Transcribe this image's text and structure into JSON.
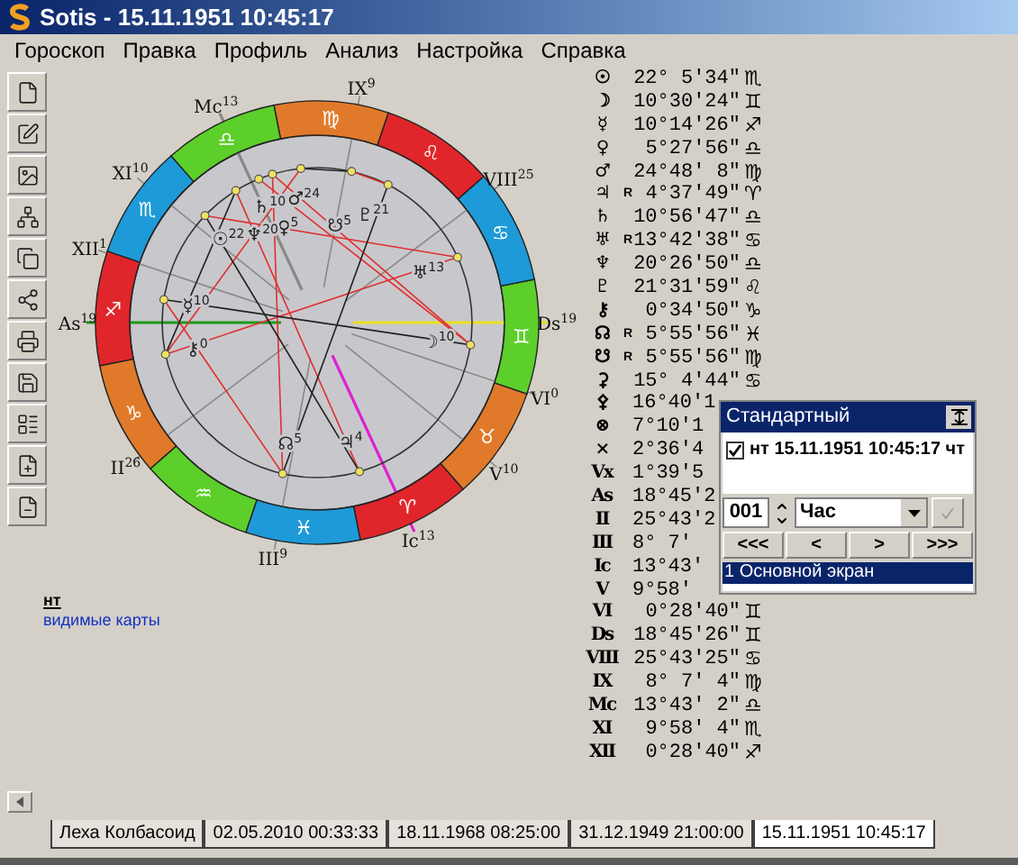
{
  "window": {
    "title": "Sotis - 15.11.1951 10:45:17"
  },
  "menu": [
    "Гороскоп",
    "Правка",
    "Профиль",
    "Анализ",
    "Настройка",
    "Справка"
  ],
  "zodiac": [
    {
      "glyph": "♈",
      "color": "#e0262a"
    },
    {
      "glyph": "♉",
      "color": "#e07a2a"
    },
    {
      "glyph": "♊",
      "color": "#5ccf2a"
    },
    {
      "glyph": "♋",
      "color": "#1e9ad8"
    },
    {
      "glyph": "♌",
      "color": "#e0262a"
    },
    {
      "glyph": "♍",
      "color": "#e07a2a"
    },
    {
      "glyph": "♎",
      "color": "#5ccf2a"
    },
    {
      "glyph": "♏",
      "color": "#1e9ad8"
    },
    {
      "glyph": "♐",
      "color": "#e0262a"
    },
    {
      "glyph": "♑",
      "color": "#e07a2a"
    },
    {
      "glyph": "♒",
      "color": "#5ccf2a"
    },
    {
      "glyph": "♓",
      "color": "#1e9ad8"
    }
  ],
  "house_labels": [
    {
      "name": "IX",
      "degree": "9"
    },
    {
      "name": "Mc",
      "degree": "13"
    },
    {
      "name": "XI",
      "degree": "10"
    },
    {
      "name": "VIII",
      "degree": "25"
    },
    {
      "name": "XII",
      "degree": "1"
    },
    {
      "name": "As",
      "degree": "19"
    },
    {
      "name": "Ds",
      "degree": "19"
    },
    {
      "name": "VI",
      "degree": "0"
    },
    {
      "name": "II",
      "degree": "26"
    },
    {
      "name": "V",
      "degree": "10"
    },
    {
      "name": "Ic",
      "degree": "13"
    },
    {
      "name": "III",
      "degree": "9"
    }
  ],
  "chart_planets": [
    {
      "glyph": "☉",
      "degree": "22"
    },
    {
      "glyph": "☽",
      "degree": "10"
    },
    {
      "glyph": "☿",
      "degree": "10"
    },
    {
      "glyph": "♀",
      "degree": "5"
    },
    {
      "glyph": "♂",
      "degree": "24"
    },
    {
      "glyph": "♃",
      "degree": "4"
    },
    {
      "glyph": "♄",
      "degree": "10"
    },
    {
      "glyph": "♅",
      "degree": "13"
    },
    {
      "glyph": "♆",
      "degree": "20"
    },
    {
      "glyph": "♇",
      "degree": "21"
    },
    {
      "glyph": "⚷",
      "degree": "0"
    },
    {
      "glyph": "☊",
      "degree": "5"
    },
    {
      "glyph": "☋",
      "degree": "5"
    }
  ],
  "legend": {
    "title": "нт",
    "link": "видимые карты"
  },
  "positions": [
    {
      "glyph": "☉",
      "value": "22° 5′34″",
      "sign": "♏"
    },
    {
      "glyph": "☽",
      "value": "10°30′24″",
      "sign": "♊"
    },
    {
      "glyph": "☿",
      "value": "10°14′26″",
      "sign": "♐"
    },
    {
      "glyph": "♀",
      "value": "5°27′56″",
      "sign": "♎"
    },
    {
      "glyph": "♂",
      "value": "24°48′ 8″",
      "sign": "♍"
    },
    {
      "glyph": "♃",
      "flag": "R",
      "value": "4°37′49″",
      "sign": "♈"
    },
    {
      "glyph": "♄",
      "value": "10°56′47″",
      "sign": "♎"
    },
    {
      "glyph": "♅",
      "flag": "R",
      "value": "13°42′38″",
      "sign": "♋"
    },
    {
      "glyph": "♆",
      "value": "20°26′50″",
      "sign": "♎"
    },
    {
      "glyph": "♇",
      "value": "21°31′59″",
      "sign": "♌"
    },
    {
      "glyph": "⚷",
      "value": "0°34′50″",
      "sign": "♑"
    },
    {
      "glyph": "☊",
      "flag": "R",
      "value": "5°55′56″",
      "sign": "♓"
    },
    {
      "glyph": "☋",
      "flag": "R",
      "value": "5°55′56″",
      "sign": "♍"
    },
    {
      "glyph": "⚳",
      "value": "15° 4′44″",
      "sign": "♋"
    },
    {
      "glyph": "⚴",
      "value": "16°40′1"
    },
    {
      "glyph": "⊗",
      "value": "7°10′1"
    },
    {
      "glyph": "×",
      "value": "2°36′4"
    },
    {
      "glyph": "Vx",
      "value": "1°39′5"
    },
    {
      "glyph": "As",
      "value": "18°45′2"
    },
    {
      "glyph": "II",
      "value": "25°43′2"
    },
    {
      "glyph": "III",
      "value": "8° 7′"
    },
    {
      "glyph": "Ic",
      "value": "13°43′"
    },
    {
      "glyph": "V",
      "value": "9°58′"
    },
    {
      "glyph": "VI",
      "value": "0°28′40″",
      "sign": "♊"
    },
    {
      "glyph": "Ds",
      "value": "18°45′26″",
      "sign": "♊"
    },
    {
      "glyph": "VIII",
      "value": "25°43′25″",
      "sign": "♋"
    },
    {
      "glyph": "IX",
      "value": "8° 7′ 4″",
      "sign": "♍"
    },
    {
      "glyph": "Mc",
      "value": "13°43′ 2″",
      "sign": "♎"
    },
    {
      "glyph": "XI",
      "value": "9°58′ 4″",
      "sign": "♏"
    },
    {
      "glyph": "XII",
      "value": "0°28′40″",
      "sign": "♐"
    }
  ],
  "panel": {
    "title": "Стандартный",
    "entries": [
      {
        "label": "нт 15.11.1951 10:45:17 чт",
        "checked": true
      }
    ],
    "step": "001",
    "unit": "Час",
    "nav": [
      "<<<",
      "<",
      ">",
      ">>>"
    ],
    "screens": [
      {
        "label": "1 Основной экран",
        "selected": true
      }
    ]
  },
  "tabs": [
    {
      "label": "Леха Колбасоид",
      "selected": false
    },
    {
      "label": "02.05.2010 00:33:33",
      "selected": false
    },
    {
      "label": "18.11.1968 08:25:00",
      "selected": false
    },
    {
      "label": "31.12.1949 21:00:00",
      "selected": false
    },
    {
      "label": "15.11.1951 10:45:17",
      "selected": true
    }
  ]
}
